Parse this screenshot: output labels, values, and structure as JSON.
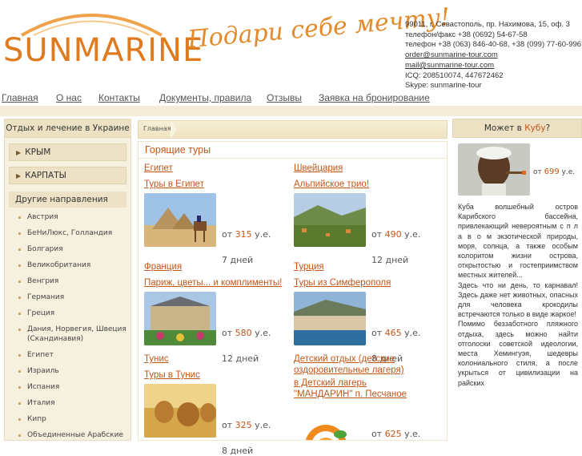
{
  "header": {
    "logo": "SUNMARINE",
    "slogan": "Подари себе мечту!",
    "contacts": {
      "address": "99011, г. Севастополь, пр. Нахимова, 15, оф. 3",
      "phone_fax": "телефон/факс +38 (0692) 54-67-58",
      "phones": "телефон +38 (063) 846-40-68, +38 (099) 77-60-996",
      "email_order": "order@sunmarine-tour.com",
      "email_mail": "mail@sunmarine-tour.com",
      "icq": "ICQ: 208510074, 447672462",
      "skype": "Skype: sunmarine-tour"
    }
  },
  "nav": [
    "Главная",
    "О нас",
    "Контакты",
    "Документы, правила",
    "Отзывы",
    "Заявка на бронирование"
  ],
  "left": {
    "head": "Отдых и лечение в Украине",
    "regions": [
      "КРЫМ",
      "КАРПАТЫ"
    ],
    "other_head": "Другие направления",
    "directions": [
      "Австрия",
      "БеНиЛюкс, Голландия",
      "Болгария",
      "Великобритания",
      "Венгрия",
      "Германия",
      "Греция",
      "Дания, Норвегия, Швеция (Скандинавия)",
      "Египет",
      "Израиль",
      "Испания",
      "Италия",
      "Кипр",
      "Объединенные Арабские"
    ]
  },
  "main": {
    "breadcrumb": "Главная",
    "title": "Горящие туры",
    "tours": [
      {
        "country": "Египет",
        "name": "Туры в Египет",
        "price_prefix": "от ",
        "price": "315",
        "currency": " у.е.",
        "days": "7 дней"
      },
      {
        "country": "Швейцария",
        "name": "Альпийское трио!",
        "price_prefix": "от ",
        "price": "490",
        "currency": " у.е.",
        "days": "12 дней"
      },
      {
        "country": "Франция",
        "name": "Париж, цветы... и комплименты!",
        "price_prefix": "от ",
        "price": "580",
        "currency": " у.е.",
        "days": "12 дней"
      },
      {
        "country": "Турция",
        "name": "Туры из Симферополя",
        "price_prefix": "от ",
        "price": "465",
        "currency": " у.е.",
        "days": "8 дней"
      },
      {
        "country": "Тунис",
        "name": "Туры в Тунис",
        "price_prefix": "от ",
        "price": "325",
        "currency": " у.е.",
        "days": "8 дней"
      },
      {
        "country": "Детский отдых (детские",
        "country2": "оздоровительные лагеря)",
        "name": "в Детский лагерь",
        "name2": "\"МАНДАРИН\" п. Песчаное",
        "price_prefix": "от ",
        "price": "625",
        "currency": " у.е."
      }
    ]
  },
  "right": {
    "head_prefix": "Может в ",
    "head_link": "Кубу",
    "head_suffix": "?",
    "price_prefix": "от ",
    "price": "699",
    "currency": " у.е.",
    "text1": "Куба  волшебный остров Карибского бассейна, привлекающий невероятным с п л а в о м экзотической природы, моря, солнца, а также особым колоритом жизни острова, открытостью и гостеприимством местных жителей...",
    "text2": "Здесь что ни день, то карнавал! Здесь даже нет животных, опасных для человека   крокодилы встречаются только в виде жаркое!",
    "text3": "Помимо беззаботного пляжного отдыха, здесь можно найти отголоски советской идеологии, места Хемингуэя, шедевры колониального стиля, а после       укрыться от цивилизации на райских"
  },
  "colors": {
    "accent": "#c4561a",
    "logo": "#e07a1e",
    "panel_bg": "#f6f0df"
  }
}
